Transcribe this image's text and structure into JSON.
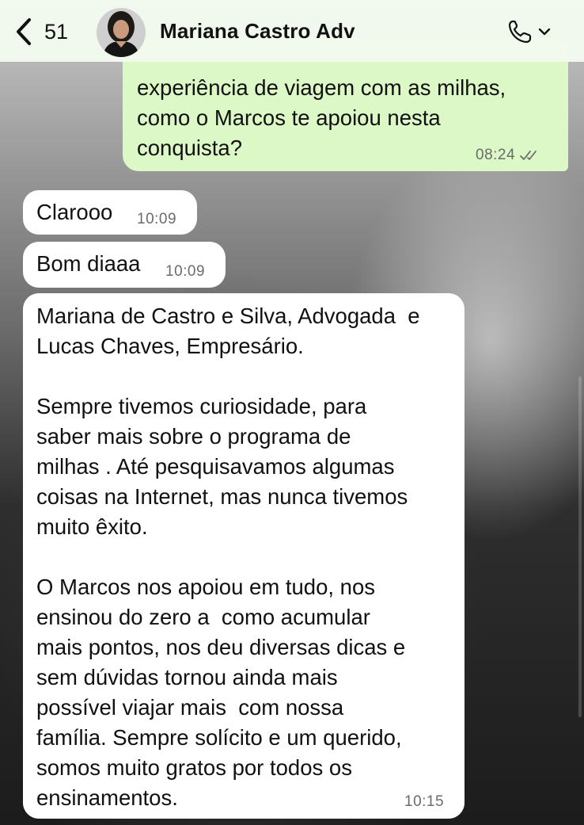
{
  "header": {
    "back_count": "51",
    "contact_name": "Mariana Castro Adv",
    "icons": {
      "back": "chevron-left-icon",
      "call": "phone-icon",
      "menu": "chevron-down-icon"
    }
  },
  "messages": [
    {
      "direction": "outgoing",
      "text": "experiência de viagem com as milhas,\ncomo o Marcos te apoiou nesta\nconquista?",
      "time": "08:24",
      "status": "read"
    },
    {
      "direction": "incoming",
      "text": "Clarooo",
      "time": "10:09"
    },
    {
      "direction": "incoming",
      "text": "Bom diaaa",
      "time": "10:09"
    },
    {
      "direction": "incoming",
      "text": "Mariana de Castro e Silva, Advogada  e\nLucas Chaves, Empresário.\n\nSempre tivemos curiosidade, para\nsaber mais sobre o programa de\nmilhas . Até pesquisavamos algumas\ncoisas na Internet, mas nunca tivemos\nmuito êxito.\n\nO Marcos nos apoiou em tudo, nos\nensinou do zero a  como acumular\nmais pontos, nos deu diversas dicas e\nsem dúvidas tornou ainda mais\npossível viajar mais  com nossa\nfamília. Sempre solícito e um querido,\nsomos muito gratos por todos os\nensinamentos.",
      "time": "10:15"
    }
  ],
  "colors": {
    "outgoing_bubble": "#dcf8c6",
    "incoming_bubble": "#ffffff",
    "header_bg": "#f3faee",
    "read_check": "#6b6b6b"
  }
}
